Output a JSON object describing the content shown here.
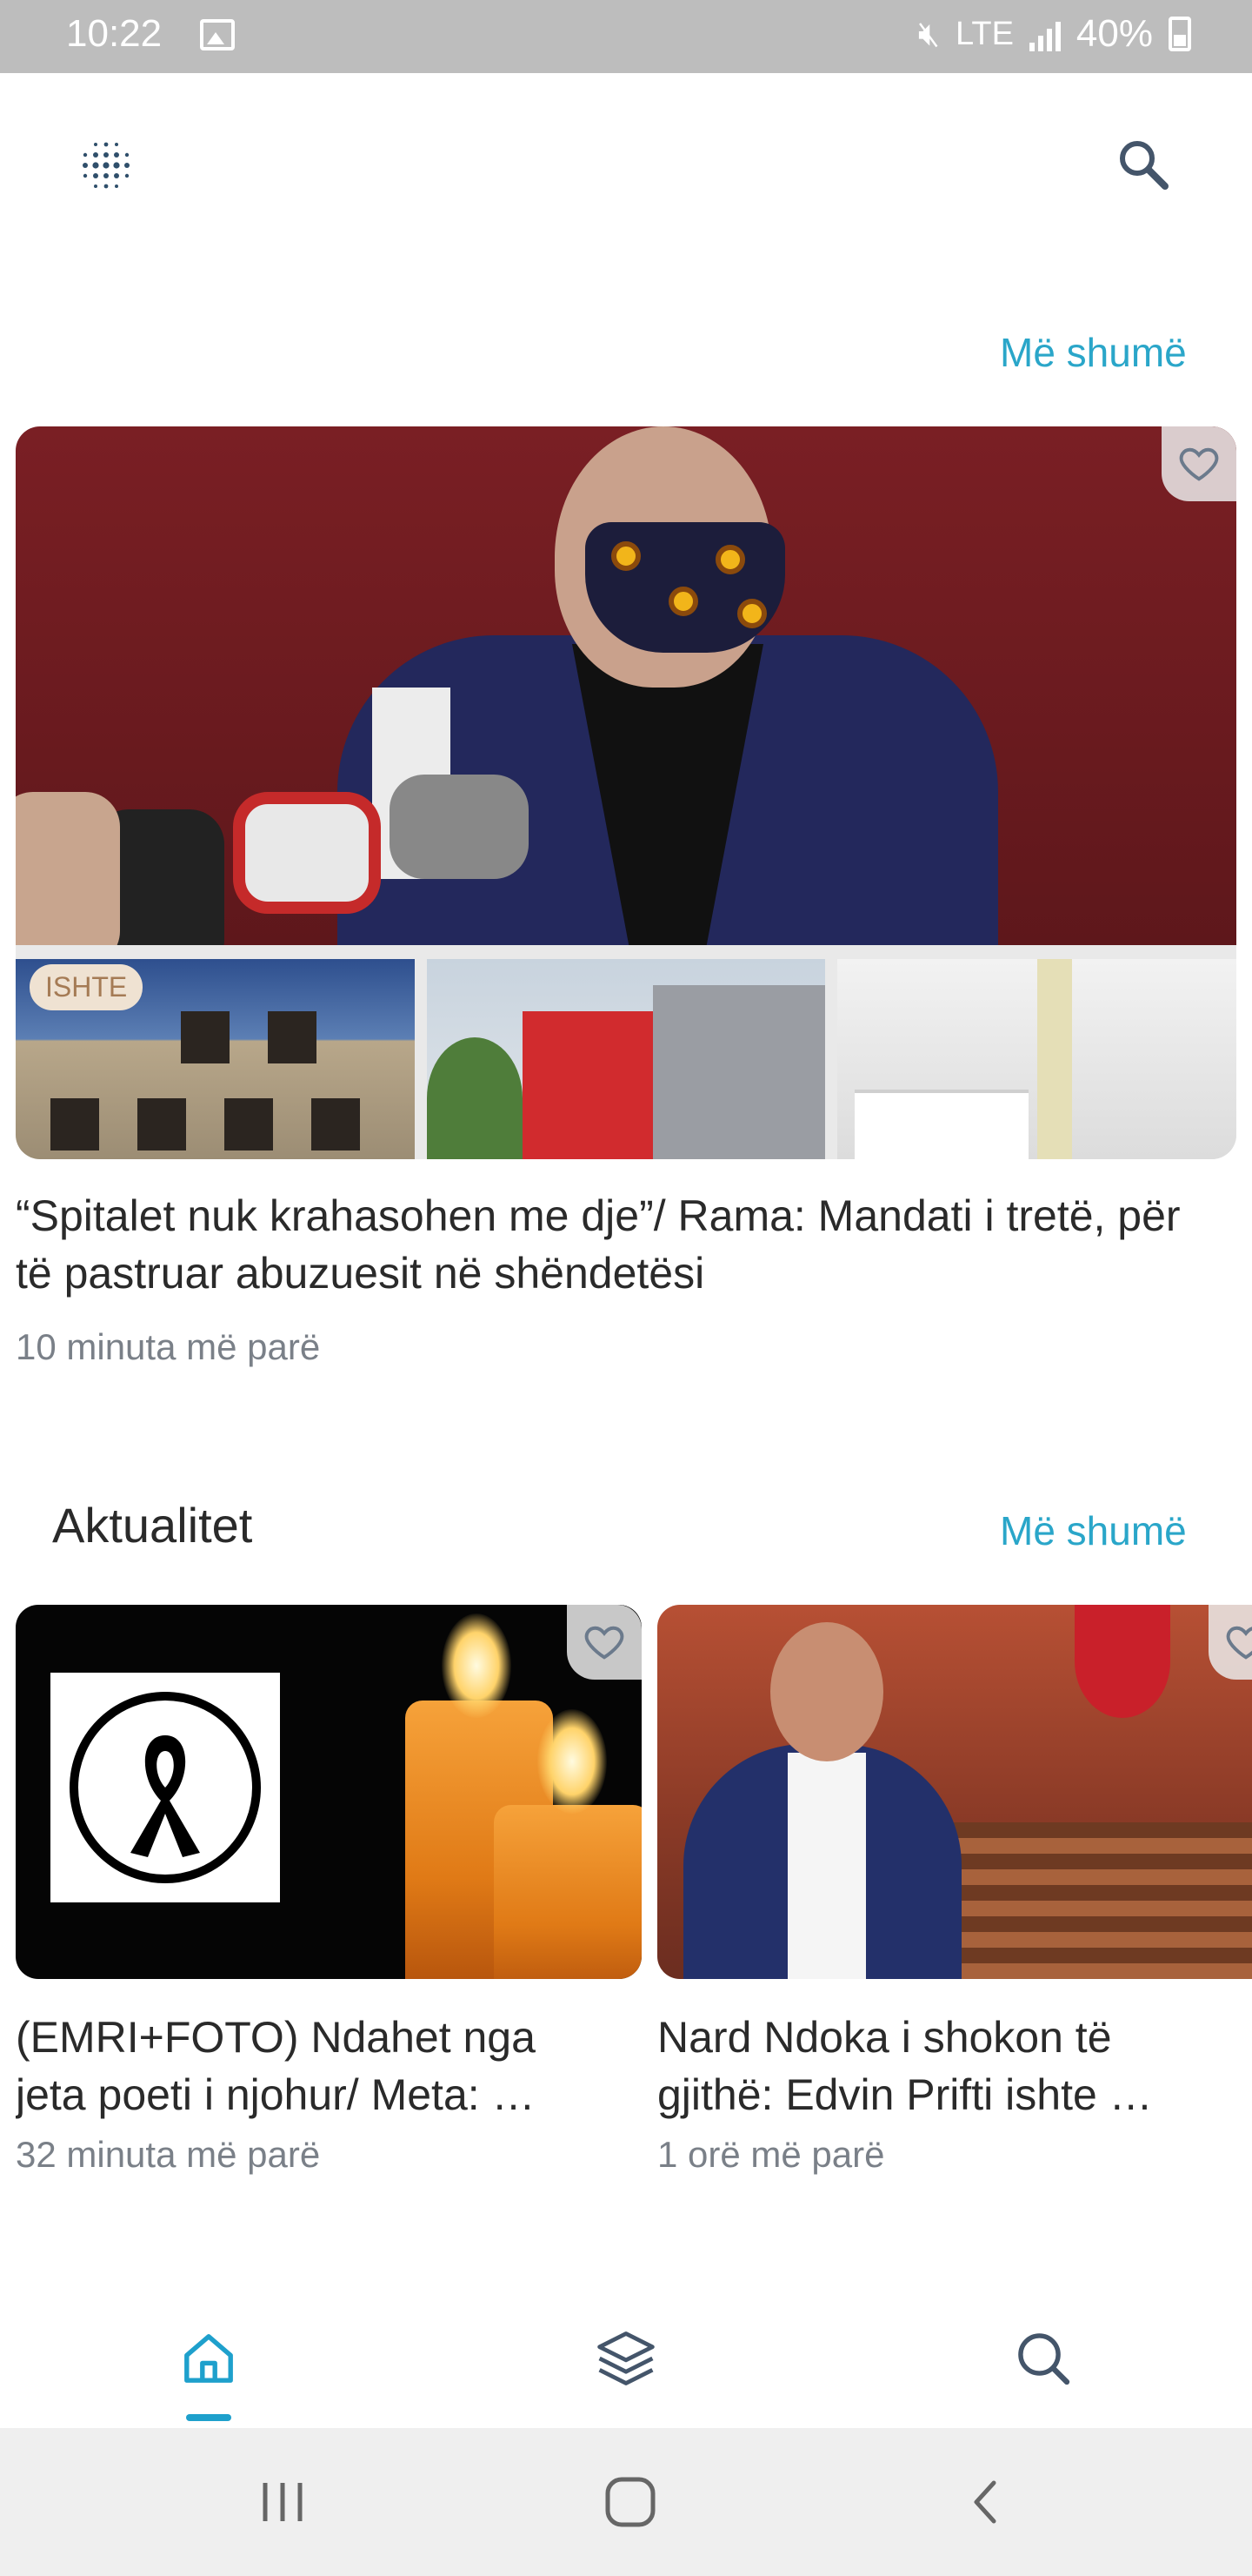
{
  "status_bar": {
    "time": "10:22",
    "network": "LTE",
    "battery": "40%",
    "icons": [
      "gallery-icon",
      "mute-icon",
      "signal-icon",
      "battery-icon"
    ]
  },
  "header": {
    "menu_icon": "grid-dots-icon",
    "search_icon": "search-icon"
  },
  "top_section": {
    "more_label": "Më shumë"
  },
  "hero_article": {
    "badge": "ISHTE",
    "title": "“Spitalet nuk krahasohen me dje”/ Rama: Mandati i tretë, për të pastruar abuzuesit në shëndetësi",
    "time": "10 minuta më parë"
  },
  "aktualitet": {
    "title": "Aktualitet",
    "more_label": "Më shumë",
    "articles": [
      {
        "title_line1": "(EMRI+FOTO) Ndahet nga",
        "title_line2": "jeta poeti i njohur/ Meta: …",
        "time": "32 minuta më parë"
      },
      {
        "title_line1": "Nard Ndoka i shokon të",
        "title_line2": "gjithë: Edvin Prifti ishte …",
        "time": "1 orë më parë"
      }
    ]
  },
  "bottom_nav": {
    "items": [
      "home-icon",
      "layers-icon",
      "search-icon"
    ],
    "active": "home-icon",
    "accent": "#1ea0cc"
  },
  "system_nav": {
    "items": [
      "recents-icon",
      "home-circle-icon",
      "back-icon"
    ]
  },
  "colors": {
    "link": "#2aa6c9",
    "muted_text": "#7a8088",
    "status_bar": "#bdbdbd"
  }
}
